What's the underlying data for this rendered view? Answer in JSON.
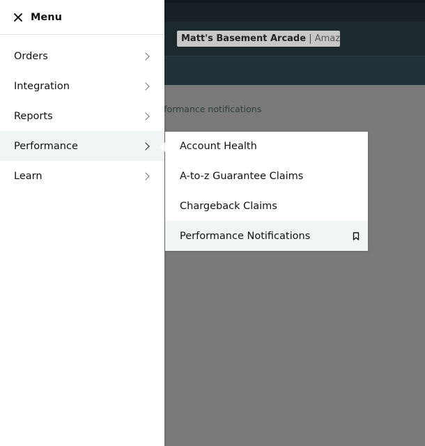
{
  "background": {
    "store_name": "Matt's Basement Arcade",
    "store_separator": "|",
    "store_marketplace": "Amazo...",
    "breadcrumb": "rformance notifications"
  },
  "drawer": {
    "title": "Menu",
    "items": [
      {
        "label": "Orders"
      },
      {
        "label": "Integration"
      },
      {
        "label": "Reports"
      },
      {
        "label": "Performance"
      },
      {
        "label": "Learn"
      }
    ]
  },
  "submenu": {
    "items": [
      {
        "label": "Account Health"
      },
      {
        "label": "A-to-z Guarantee Claims"
      },
      {
        "label": "Chargeback Claims"
      },
      {
        "label": "Performance Notifications"
      }
    ]
  },
  "icons": {
    "close": "close-icon",
    "chevron": "chevron-right-icon",
    "bookmark": "bookmark-icon"
  }
}
